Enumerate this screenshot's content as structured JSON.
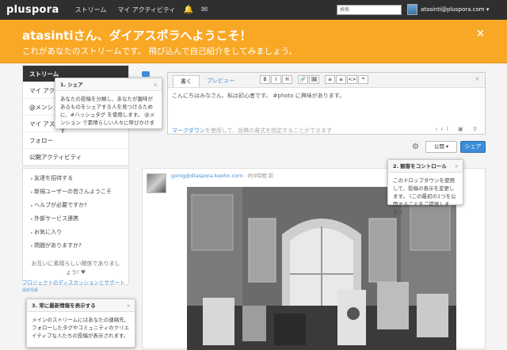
{
  "topbar": {
    "logo": "pluspora",
    "nav": [
      "ストリーム",
      "マイ アクティビティ"
    ],
    "icons": [
      "bell-icon",
      "mail-icon"
    ],
    "search_placeholder": "検索",
    "user_email": "atasinti@pluspora.com",
    "user_caret": "▾"
  },
  "banner": {
    "title": "atasintiさん、ダイアスポラへようこそ！",
    "subtitle": "これがあなたのストリームです。 飛び込んで自己紹介をしてみましょう。",
    "close": "×"
  },
  "sidebar": {
    "items": [
      "ストリーム",
      "マイ アク",
      "@メンショ",
      "マイ アスペ",
      "フォロー",
      "公開アクティビティ"
    ],
    "links": [
      "友達を招待する",
      "新規ユーザーの皆さんようこそ",
      "ヘルプが必要ですか?",
      "外部サービス連携",
      "お気に入り",
      "問題がありますか?"
    ],
    "message": "お互いに素晴らしい関係でありましょう! ♥",
    "project_link": "プロジェクトのディスカッションとサポート",
    "project_sub": "最新情報"
  },
  "tip1": {
    "title": "1. シェア",
    "close": "×",
    "body": "あなたの投稿を分類し、あなたが趣味があるものをシェアする人を見つけるために、#ハッシュタグ を使用します。 @メンション で素晴らしい人々に呼びかけます"
  },
  "tip2": {
    "title": "2. 観客をコントロール",
    "close": "×",
    "body": "このドロップダウンを使用して、投稿の表示を変更します。 (この最初の1つを公開することをご提案します。)"
  },
  "tip3": {
    "title": "3. 常に最新情報を表示する",
    "close": "×",
    "body": "メインのストリームにはあなたの連絡先、フォローしたタグやコミュニティのクリエイティブな人たちの投稿が表示されます。"
  },
  "composer": {
    "tabs": [
      "書く",
      "プレビュー"
    ],
    "toolbar": [
      "B",
      "I",
      "H",
      "🔗",
      "🖼",
      "≡",
      "≡",
      "<>",
      "❝"
    ],
    "text": "こんにちはみなさん、私は初心者です。 #photo に興味があります。",
    "hint_link": "マークダウン",
    "hint_rest": "を使用して、投稿の書式を指定することができます",
    "close": "×",
    "icons": "ııl ▣ ⚲"
  },
  "actions": {
    "gear": "⚙",
    "public_label": "公開 ▾",
    "share_label": "シェア"
  },
  "post": {
    "author": "gonig@diaspora.koehn.com",
    "time": " - 約9時間 前"
  },
  "colors": {
    "topbar": "#2f2f2f",
    "banner": "#f9a825",
    "link": "#3b8ed7"
  }
}
